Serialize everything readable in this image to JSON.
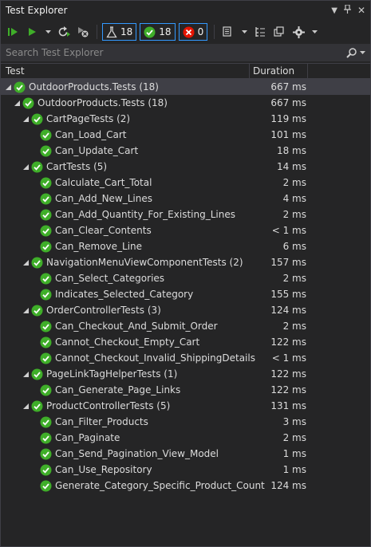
{
  "window": {
    "title": "Test Explorer"
  },
  "toolbar": {
    "passed_count_icon": "check-circle",
    "counts": {
      "total": "18",
      "passed": "18",
      "failed": "0"
    }
  },
  "search": {
    "placeholder": "Search Test Explorer",
    "value": ""
  },
  "columns": {
    "test": "Test",
    "duration": "Duration"
  },
  "colors": {
    "pass": "#3fae29",
    "fail": "#e51400",
    "accent": "#3399ff",
    "bg": "#252526"
  },
  "tests": [
    {
      "name": "OutdoorProducts.Tests (18)",
      "duration": "667 ms",
      "level": 0,
      "group": true,
      "selected": true
    },
    {
      "name": "OutdoorProducts.Tests (18)",
      "duration": "667 ms",
      "level": 1,
      "group": true
    },
    {
      "name": "CartPageTests (2)",
      "duration": "119 ms",
      "level": 2,
      "group": true
    },
    {
      "name": "Can_Load_Cart",
      "duration": "101 ms",
      "level": 3
    },
    {
      "name": "Can_Update_Cart",
      "duration": "18 ms",
      "level": 3
    },
    {
      "name": "CartTests (5)",
      "duration": "14 ms",
      "level": 2,
      "group": true
    },
    {
      "name": "Calculate_Cart_Total",
      "duration": "2 ms",
      "level": 3
    },
    {
      "name": "Can_Add_New_Lines",
      "duration": "4 ms",
      "level": 3
    },
    {
      "name": "Can_Add_Quantity_For_Existing_Lines",
      "duration": "2 ms",
      "level": 3
    },
    {
      "name": "Can_Clear_Contents",
      "duration": "< 1 ms",
      "level": 3
    },
    {
      "name": "Can_Remove_Line",
      "duration": "6 ms",
      "level": 3
    },
    {
      "name": "NavigationMenuViewComponentTests (2)",
      "duration": "157 ms",
      "level": 2,
      "group": true
    },
    {
      "name": "Can_Select_Categories",
      "duration": "2 ms",
      "level": 3
    },
    {
      "name": "Indicates_Selected_Category",
      "duration": "155 ms",
      "level": 3
    },
    {
      "name": "OrderControllerTests (3)",
      "duration": "124 ms",
      "level": 2,
      "group": true
    },
    {
      "name": "Can_Checkout_And_Submit_Order",
      "duration": "2 ms",
      "level": 3
    },
    {
      "name": "Cannot_Checkout_Empty_Cart",
      "duration": "122 ms",
      "level": 3
    },
    {
      "name": "Cannot_Checkout_Invalid_ShippingDetails",
      "duration": "< 1 ms",
      "level": 3
    },
    {
      "name": "PageLinkTagHelperTests (1)",
      "duration": "122 ms",
      "level": 2,
      "group": true
    },
    {
      "name": "Can_Generate_Page_Links",
      "duration": "122 ms",
      "level": 3
    },
    {
      "name": "ProductControllerTests (5)",
      "duration": "131 ms",
      "level": 2,
      "group": true
    },
    {
      "name": "Can_Filter_Products",
      "duration": "3 ms",
      "level": 3
    },
    {
      "name": "Can_Paginate",
      "duration": "2 ms",
      "level": 3
    },
    {
      "name": "Can_Send_Pagination_View_Model",
      "duration": "1 ms",
      "level": 3
    },
    {
      "name": "Can_Use_Repository",
      "duration": "1 ms",
      "level": 3
    },
    {
      "name": "Generate_Category_Specific_Product_Count",
      "duration": "124 ms",
      "level": 3
    }
  ]
}
